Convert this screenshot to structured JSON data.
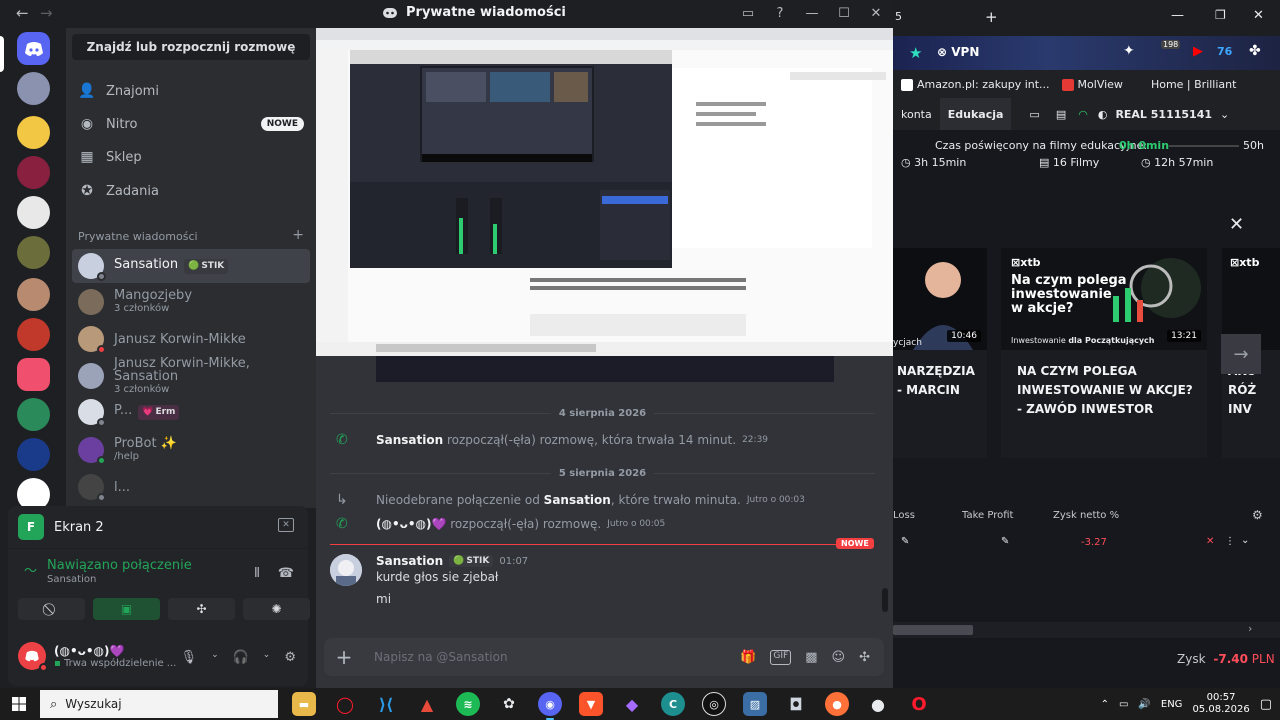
{
  "titlebar": {
    "title": "Prywatne wiadomości"
  },
  "dm": {
    "find_label": "Znajdź lub rozpocznij rozmowę",
    "nav": [
      {
        "label": "Znajomi",
        "icon": "friends-icon"
      },
      {
        "label": "Nitro",
        "icon": "nitro-icon",
        "badge": "NOWE"
      },
      {
        "label": "Sklep",
        "icon": "shop-icon"
      },
      {
        "label": "Zadania",
        "icon": "quests-icon"
      }
    ],
    "section_label": "Prywatne wiadomości",
    "section_add": "+",
    "items": [
      {
        "name": "Sansation",
        "tag": "STIK",
        "sub": "",
        "avatar_color": "#c8d0e0",
        "status": "#80848e"
      },
      {
        "name": "Mangozjeby",
        "sub": "3 członków",
        "avatar_color": "#7a6b5a",
        "status": ""
      },
      {
        "name": "Janusz Korwin-Mikke",
        "sub": "",
        "avatar_color": "#b89a7a",
        "status": "#f23f43"
      },
      {
        "name": "Janusz Korwin-Mikke, Sansation",
        "sub": "3 członków",
        "avatar_color": "#9aa3b8",
        "status": ""
      },
      {
        "name": "P...",
        "tag": "Erm",
        "sub": "",
        "avatar_color": "#d8dde6",
        "status": "#80848e"
      },
      {
        "name": "ProBot",
        "tag_sparkle": "✨",
        "sub": "/help",
        "avatar_color": "#6b3fa0",
        "status": "#23a559"
      },
      {
        "name": "l...",
        "sub": "",
        "avatar_color": "#444",
        "status": "#80848e"
      }
    ]
  },
  "voice": {
    "app_title": "Ekran 2",
    "app_icon_letter": "F",
    "status": "Nawiązano połączenie",
    "channel": "Sansation",
    "user_name": "(◍•ᴗ•◍)💜",
    "user_status": "Trwa współdzielenie ..."
  },
  "chat": {
    "date1": "4 sierpnia 2026",
    "call1": {
      "user": "Sansation",
      "text": "rozpoczął(-ęła) rozmowę, która trwała 14 minut.",
      "time": "22:39"
    },
    "date2": "5 sierpnia 2026",
    "call2": {
      "prefix": "Nieodebrane połączenie od",
      "user": "Sansation",
      "suffix": ", które trwało minuta.",
      "time": "Jutro o 00:03"
    },
    "call3": {
      "user": "(◍•ᴗ•◍)💜",
      "text": "rozpoczął(-ęła) rozmowę.",
      "time": "Jutro o 00:05"
    },
    "new_label": "NOWE",
    "message": {
      "author": "Sansation",
      "tag": "STIK",
      "time": "01:07",
      "lines": [
        "kurde głos sie zjebał",
        "mi"
      ]
    },
    "composer_placeholder": "Napisz na @Sansation"
  },
  "browser": {
    "ext_vpn": "VPN",
    "ext_badge": "198",
    "bookmarks": [
      "Amazon.pl: zakupy int...",
      "MolView",
      "Home | Brilliant"
    ],
    "xtb_tabs": [
      "konta",
      "Edukacja"
    ],
    "real_label": "REAL 51115141",
    "edu_time_label": "Czas poświęcony na filmy edukacyjne:",
    "edu_time_value": "0h 0min",
    "edu_goal": "50h",
    "stat1": "3h 15min",
    "stat2": "16 Filmy",
    "stat3": "12h 57min",
    "cards": [
      {
        "title": "NARZĘDZIA INWESTORA - MARCIN",
        "title_visible": [
          "NARZĘDZIA",
          "- MARCIN"
        ],
        "duration": "10:46",
        "caption": "ycjach"
      },
      {
        "title": "NA CZYM POLEGA INWESTOWANIE W AKCJE? - ZAWÓD INWESTOR",
        "title_lines": [
          "NA CZYM POLEGA",
          "INWESTOWANIE W AKCJE?",
          "- ZAWÓD INWESTOR"
        ],
        "duration": "13:21",
        "caption_pre": "Inwestowanie",
        "caption_post": "dla Początkujących",
        "headline": [
          "Na czym polega",
          "inwestowanie",
          "w akcje?"
        ]
      },
      {
        "title_visible": [
          "AKC",
          "RÓŻ",
          "INV"
        ]
      }
    ],
    "trade_headers": [
      "Loss",
      "Take Profit",
      "Zysk netto %"
    ],
    "trade_value": "-3.27",
    "zysk_label": "Zysk",
    "zysk_value": "-7.40",
    "zysk_currency": "PLN",
    "brand": "xtb"
  },
  "taskbar": {
    "search_placeholder": "Wyszukaj",
    "lang": "ENG",
    "time": "00:57",
    "date": "05.08.2026"
  }
}
